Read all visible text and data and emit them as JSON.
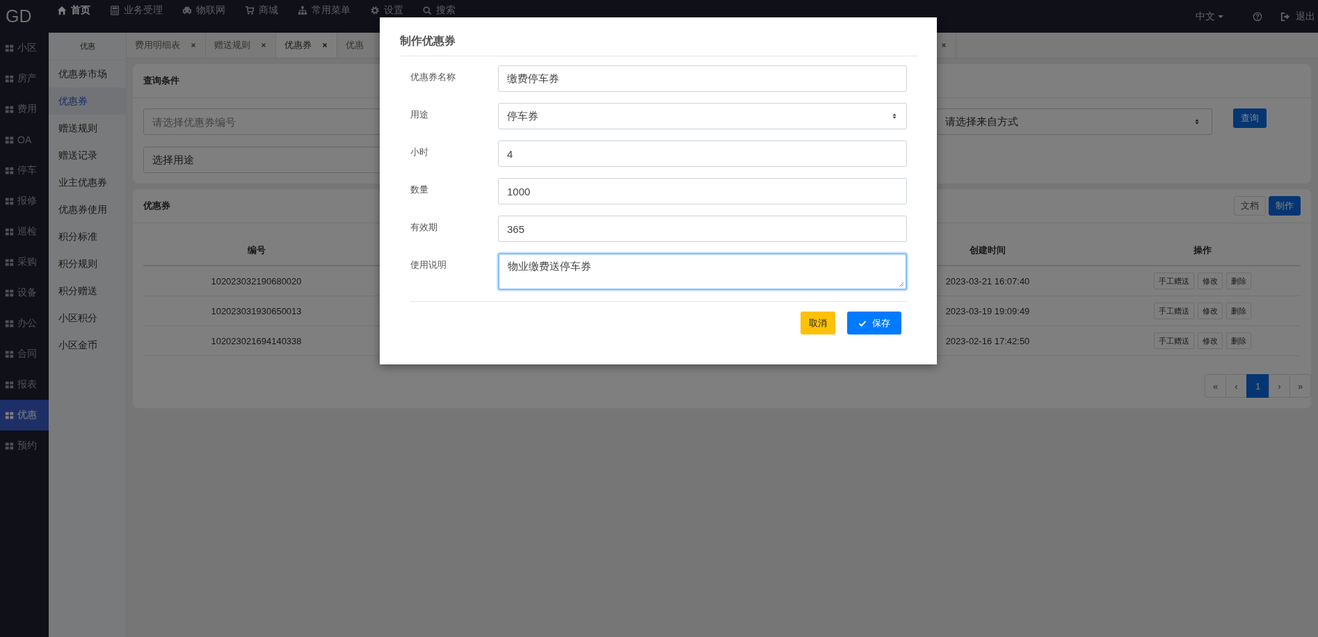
{
  "topbar": {
    "logo": "GD",
    "nav": [
      {
        "kind": "home",
        "label": "首页",
        "selected": true
      },
      {
        "kind": "calculator",
        "label": "业务受理",
        "selected": false
      },
      {
        "kind": "car",
        "label": "物联网",
        "selected": false
      },
      {
        "kind": "cart",
        "label": "商城",
        "selected": false
      },
      {
        "kind": "sitemap",
        "label": "常用菜单",
        "selected": false
      },
      {
        "kind": "gear",
        "label": "设置",
        "selected": false
      },
      {
        "kind": "search",
        "label": "搜索",
        "selected": false
      }
    ],
    "language": "中文",
    "logout": "退出"
  },
  "sidebar": {
    "items": [
      {
        "label": "小区",
        "selected": false
      },
      {
        "label": "房产",
        "selected": false
      },
      {
        "label": "费用",
        "selected": false
      },
      {
        "label": "OA",
        "selected": false
      },
      {
        "label": "停车",
        "selected": false
      },
      {
        "label": "报修",
        "selected": false
      },
      {
        "label": "巡检",
        "selected": false
      },
      {
        "label": "采购",
        "selected": false
      },
      {
        "label": "设备",
        "selected": false
      },
      {
        "label": "办公",
        "selected": false
      },
      {
        "label": "合同",
        "selected": false
      },
      {
        "label": "报表",
        "selected": false
      },
      {
        "label": "优惠",
        "selected": true
      },
      {
        "label": "预约",
        "selected": false
      }
    ]
  },
  "submenu": {
    "title": "优惠",
    "items": [
      {
        "label": "优惠券市场",
        "selected": false
      },
      {
        "label": "优惠券",
        "selected": true
      },
      {
        "label": "赠送规则",
        "selected": false
      },
      {
        "label": "赠送记录",
        "selected": false
      },
      {
        "label": "业主优惠券",
        "selected": false
      },
      {
        "label": "优惠券使用",
        "selected": false
      },
      {
        "label": "积分标准",
        "selected": false
      },
      {
        "label": "积分规则",
        "selected": false
      },
      {
        "label": "积分赠送",
        "selected": false
      },
      {
        "label": "小区积分",
        "selected": false
      },
      {
        "label": "小区金币",
        "selected": false
      }
    ]
  },
  "tabs": [
    {
      "label": "费用明细表",
      "selected": false
    },
    {
      "label": "赠送规则",
      "selected": false
    },
    {
      "label": "优惠券",
      "selected": true
    },
    {
      "label": "优惠",
      "selected": false
    }
  ],
  "query": {
    "title": "查询条件",
    "fields": [
      {
        "kind": "input",
        "placeholder": "请选择优惠券编号"
      },
      {
        "kind": "select",
        "value": "请选择来自方式"
      },
      {
        "kind": "input",
        "value": "选择用途"
      }
    ],
    "button": "查询"
  },
  "coupons": {
    "title": "优惠券",
    "buttons": [
      {
        "kind": "default",
        "label": "文档"
      },
      {
        "kind": "primary",
        "label": "制作"
      }
    ],
    "columns": [
      "编号",
      "创建时间",
      "操作"
    ],
    "rows": [
      {
        "number": "102023032190680020",
        "created": "2023-03-21 16:07:40",
        "actions": [
          "手工赠送",
          "修改",
          "删除"
        ]
      },
      {
        "number": "102023031930650013",
        "created": "2023-03-19 19:09:49",
        "actions": [
          "手工赠送",
          "修改",
          "删除"
        ]
      },
      {
        "number": "102023021694140338",
        "created": "2023-02-16 17:42:50",
        "actions": [
          "手工赠送",
          "修改",
          "删除"
        ]
      }
    ],
    "pagination": [
      {
        "label": "«",
        "selected": false
      },
      {
        "label": "‹",
        "selected": false
      },
      {
        "label": "1",
        "selected": true
      },
      {
        "label": "›",
        "selected": false
      },
      {
        "label": "»",
        "selected": false
      }
    ]
  },
  "dialog": {
    "title": "制作优惠券",
    "fields": [
      {
        "kind": "text",
        "label": "优惠券名称",
        "value": "缴费停车券",
        "focused": false
      },
      {
        "kind": "select",
        "label": "用途",
        "value": "停车券",
        "focused": false
      },
      {
        "kind": "text",
        "label": "小时",
        "value": "4",
        "focused": false
      },
      {
        "kind": "text",
        "label": "数量",
        "value": "1000",
        "focused": false
      },
      {
        "kind": "text",
        "label": "有效期",
        "value": "365",
        "focused": false
      },
      {
        "kind": "textarea",
        "label": "使用说明",
        "value": "物业缴费送停车券",
        "focused": true
      }
    ],
    "buttons": [
      {
        "kind": "warning",
        "label": "取消"
      },
      {
        "kind": "primary",
        "label": "保存"
      }
    ]
  }
}
